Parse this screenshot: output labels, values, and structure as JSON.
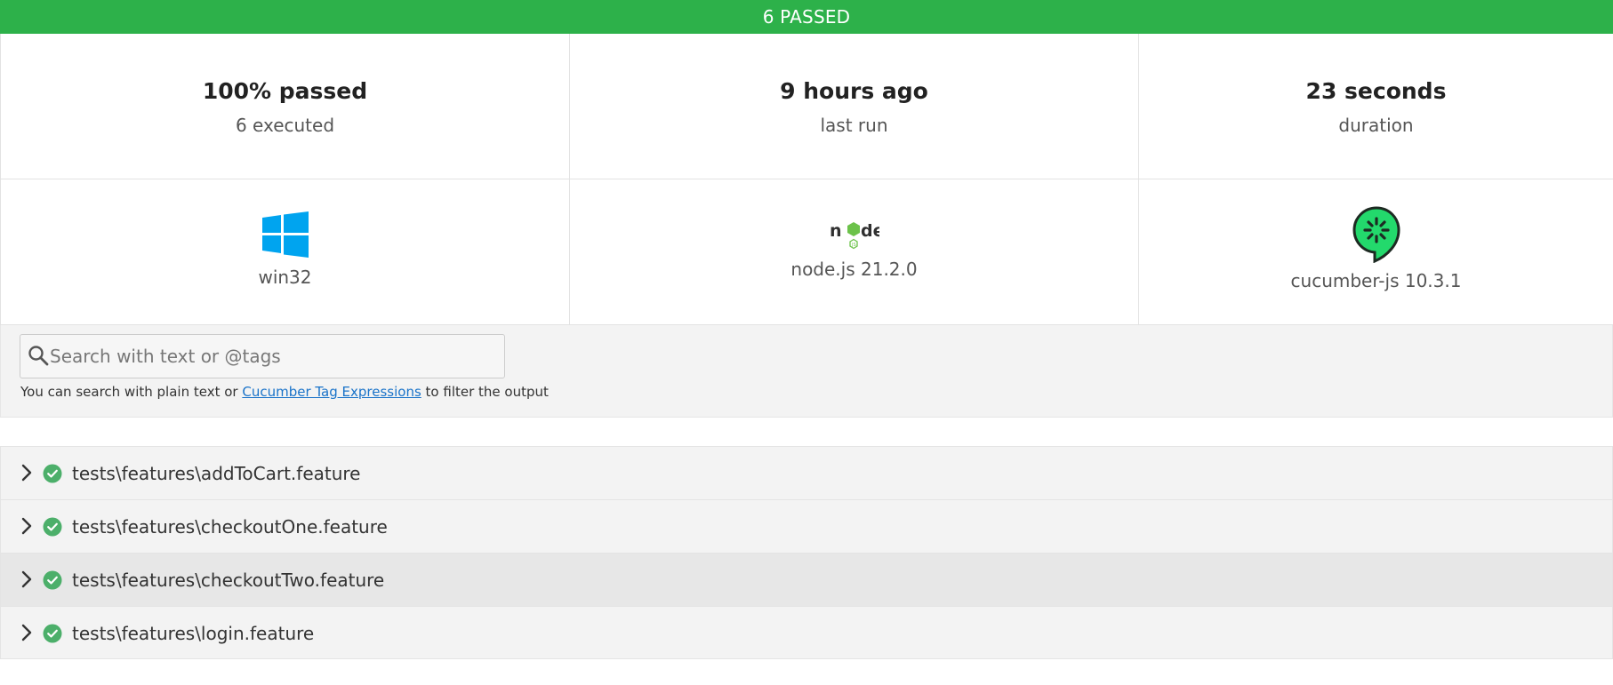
{
  "status": {
    "text": "6 PASSED",
    "color": "#2db14a"
  },
  "stats": [
    {
      "value": "100% passed",
      "label": "6 executed"
    },
    {
      "value": "9 hours ago",
      "label": "last run"
    },
    {
      "value": "23 seconds",
      "label": "duration"
    }
  ],
  "environment": [
    {
      "icon": "windows-icon",
      "label": "win32"
    },
    {
      "icon": "nodejs-icon",
      "label": "node.js 21.2.0"
    },
    {
      "icon": "cucumber-icon",
      "label": "cucumber-js 10.3.1"
    }
  ],
  "search": {
    "placeholder": "Search with text or @tags",
    "value": "",
    "help_prefix": "You can search with plain text or ",
    "help_link": "Cucumber Tag Expressions",
    "help_suffix": " to filter the output"
  },
  "features": [
    {
      "name": "tests\\features\\addToCart.feature",
      "status": "passed"
    },
    {
      "name": "tests\\features\\checkoutOne.feature",
      "status": "passed"
    },
    {
      "name": "tests\\features\\checkoutTwo.feature",
      "status": "passed"
    },
    {
      "name": "tests\\features\\login.feature",
      "status": "passed"
    }
  ],
  "colors": {
    "pass_green": "#2db14a",
    "check_green": "#4caf6a",
    "windows_blue": "#00a4ef",
    "cucumber_green": "#23d96c"
  }
}
